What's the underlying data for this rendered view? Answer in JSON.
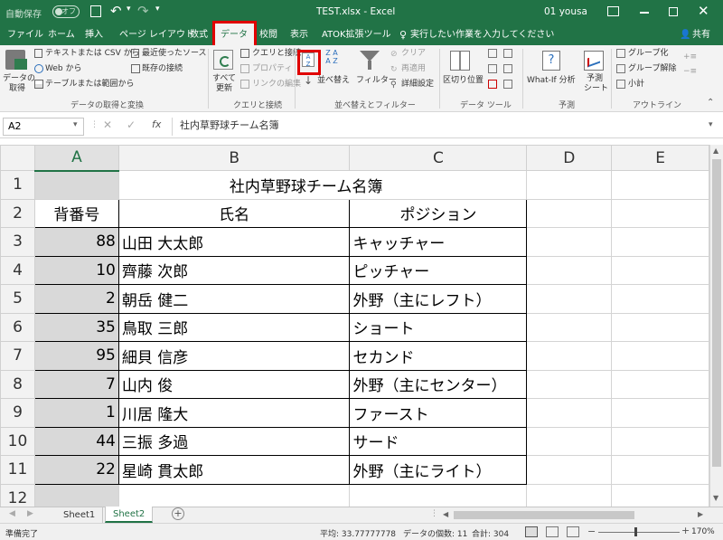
{
  "titlebar": {
    "autosave": "自動保存",
    "autosave_state": "オフ",
    "filename": "TEST.xlsx - Excel",
    "user": "01 yousa"
  },
  "tabs": [
    "ファイル",
    "ホーム",
    "挿入",
    "ページ レイアウト",
    "数式",
    "データ",
    "校閲",
    "表示",
    "ATOK拡張ツール"
  ],
  "tellme": "実行したい作業を入力してください",
  "share": "共有",
  "ribbon": {
    "get_data": "データの\n取得",
    "from_text_csv": "テキストまたは CSV から",
    "from_web": "Web から",
    "from_table": "テーブルまたは範囲から",
    "recent_sources": "最近使ったソース",
    "existing_conn": "既存の接続",
    "group1": "データの取得と変換",
    "refresh_all": "すべて\n更新",
    "queries_conn": "クエリと接続",
    "properties": "プロパティ",
    "edit_links": "リンクの編集",
    "group2": "クエリと接続",
    "sort": "並べ替え",
    "filter": "フィルター",
    "clear": "クリア",
    "reapply": "再適用",
    "advanced": "詳細設定",
    "group3": "並べ替えとフィルター",
    "text_to_columns": "区切り位置",
    "group4": "データ ツール",
    "whatif": "What-If 分析",
    "forecast": "予測\nシート",
    "group5": "予測",
    "group_btn": "グループ化",
    "ungroup": "グループ解除",
    "subtotal": "小計",
    "group6": "アウトライン"
  },
  "namebox": "A2",
  "formula": "社内草野球チーム名簿",
  "columns": [
    "A",
    "B",
    "C",
    "D",
    "E"
  ],
  "rows": [
    {
      "n": "1",
      "a": "",
      "b": "社内草野球チーム名簿",
      "c": ""
    },
    {
      "n": "2",
      "a": "背番号",
      "b": "氏名",
      "c": "ポジション"
    },
    {
      "n": "3",
      "a": "88",
      "b": "山田 大太郎",
      "c": "キャッチャー"
    },
    {
      "n": "4",
      "a": "10",
      "b": "齊藤 次郎",
      "c": "ピッチャー"
    },
    {
      "n": "5",
      "a": "2",
      "b": "朝岳 健二",
      "c": "外野（主にレフト）"
    },
    {
      "n": "6",
      "a": "35",
      "b": "鳥取 三郎",
      "c": "ショート"
    },
    {
      "n": "7",
      "a": "95",
      "b": "細貝 信彦",
      "c": "セカンド"
    },
    {
      "n": "8",
      "a": "7",
      "b": "山内 俊",
      "c": "外野（主にセンター）"
    },
    {
      "n": "9",
      "a": "1",
      "b": "川居 隆大",
      "c": "ファースト"
    },
    {
      "n": "10",
      "a": "44",
      "b": "三振 多過",
      "c": "サード"
    },
    {
      "n": "11",
      "a": "22",
      "b": "星崎 貫太郎",
      "c": "外野（主にライト）"
    },
    {
      "n": "12",
      "a": "",
      "b": "",
      "c": ""
    }
  ],
  "sheets": [
    "Sheet1",
    "Sheet2"
  ],
  "status": {
    "ready": "準備完了",
    "average": "平均: 33.77777778",
    "count": "データの個数: 11",
    "sum": "合計: 304",
    "zoom": "170%"
  },
  "colors": {
    "excel_green": "#217346",
    "highlight": "#e00000"
  }
}
